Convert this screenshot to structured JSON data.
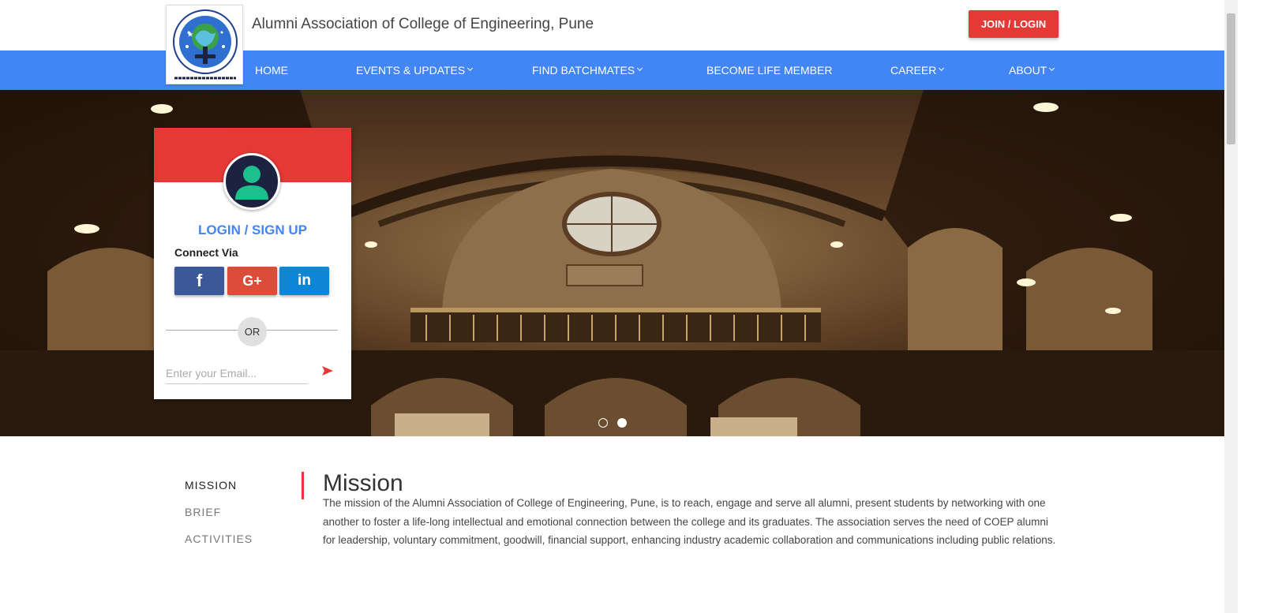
{
  "header": {
    "logo_text": "इति ... अनुशासनं अविस्मरणीयम्।",
    "title": "Alumni Association of College of Engineering, Pune",
    "join_button": "JOIN / LOGIN"
  },
  "nav": {
    "items": [
      {
        "label": "HOME",
        "dropdown": false
      },
      {
        "label": "EVENTS & UPDATES",
        "dropdown": true
      },
      {
        "label": "FIND BATCHMATES",
        "dropdown": true
      },
      {
        "label": "BECOME LIFE MEMBER",
        "dropdown": false
      },
      {
        "label": "CAREER",
        "dropdown": true
      },
      {
        "label": "ABOUT",
        "dropdown": true
      }
    ]
  },
  "hero": {
    "slides_count": 2,
    "active_slide": 2
  },
  "login_card": {
    "title": "LOGIN / SIGN UP",
    "connect_via": "Connect Via",
    "social": [
      {
        "name": "facebook",
        "glyph": "f",
        "color": "#3b5998"
      },
      {
        "name": "google-plus",
        "glyph": "G+",
        "color": "#dd4b39"
      },
      {
        "name": "linkedin",
        "glyph": "in",
        "color": "#0e86d6"
      }
    ],
    "or_label": "OR",
    "email_placeholder": "Enter your Email...",
    "header_color": "#e53935"
  },
  "about": {
    "tabs": [
      {
        "label": "MISSION",
        "active": true
      },
      {
        "label": "BRIEF",
        "active": false
      },
      {
        "label": "ACTIVITIES",
        "active": false
      }
    ],
    "title": "Mission",
    "text": "The mission of the Alumni Association of College of Engineering, Pune, is to reach, engage and serve all alumni, present students by networking with one another to foster a life-long intellectual and emotional connection between the college and its graduates. The association serves the need of COEP alumni for leadership, voluntary commitment, goodwill, financial support, enhancing industry academic collaboration and communications including public relations."
  },
  "colors": {
    "nav_blue": "#4285f4",
    "accent_red": "#e53935"
  }
}
